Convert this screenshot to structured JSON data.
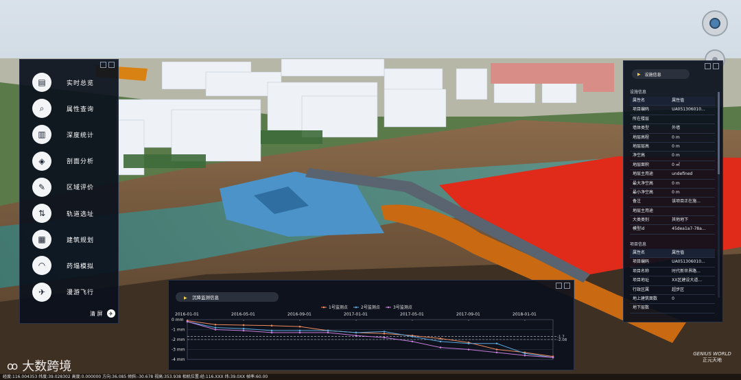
{
  "left_menu": {
    "items": [
      {
        "label": "实时总览",
        "icon": "dashboard-icon"
      },
      {
        "label": "属性查询",
        "icon": "property-search-icon"
      },
      {
        "label": "深度统计",
        "icon": "statistics-icon"
      },
      {
        "label": "剖面分析",
        "icon": "section-analysis-icon"
      },
      {
        "label": "区域评价",
        "icon": "area-evaluation-icon"
      },
      {
        "label": "轨道选址",
        "icon": "rail-site-icon"
      },
      {
        "label": "建筑规划",
        "icon": "building-plan-icon"
      },
      {
        "label": "药塌模拟",
        "icon": "collapse-sim-icon"
      },
      {
        "label": "漫游飞行",
        "icon": "plane-icon"
      }
    ],
    "clear_label": "清 屏"
  },
  "right_panel": {
    "header": "设施信息",
    "facility": {
      "title": "设施信息",
      "col_name": "属性名",
      "col_value": "属性值",
      "rows": [
        {
          "k": "项目编码",
          "v": "UA051306010..."
        },
        {
          "k": "所在楼层",
          "v": ""
        },
        {
          "k": "墙体类型",
          "v": "外墙"
        },
        {
          "k": "地层高程",
          "v": "0 m"
        },
        {
          "k": "地层层高",
          "v": "0 m"
        },
        {
          "k": "净空高",
          "v": "0 m"
        },
        {
          "k": "地层面积",
          "v": "0 ㎡"
        },
        {
          "k": "地层主用途",
          "v": "undefined"
        },
        {
          "k": "最大净空高",
          "v": "0 m"
        },
        {
          "k": "最小净空高",
          "v": "0 m"
        },
        {
          "k": "备注",
          "v": "该项目正在施..."
        },
        {
          "k": "地层主用途",
          "v": ""
        },
        {
          "k": "大类类别",
          "v": "其他地下"
        },
        {
          "k": "模型id",
          "v": "45dea1a7-78a..."
        }
      ]
    },
    "project": {
      "title": "项目信息",
      "col_name": "属性名",
      "col_value": "属性值",
      "rows": [
        {
          "k": "项目编码",
          "v": "UA051306010..."
        },
        {
          "k": "项目名称",
          "v": "时代新世界路..."
        },
        {
          "k": "项目地址",
          "v": "XX区建设大道..."
        },
        {
          "k": "行政区属",
          "v": "超步区"
        },
        {
          "k": "地上建筑面数",
          "v": "0"
        },
        {
          "k": "地下层数",
          "v": ""
        }
      ]
    }
  },
  "chart_panel": {
    "header": "沉降监测信息"
  },
  "chart_data": {
    "type": "line",
    "x": [
      "2016-01-01",
      "2016-03-01",
      "2016-05-01",
      "2016-07-01",
      "2016-09-01",
      "2016-11-01",
      "2017-01-01",
      "2017-03-01",
      "2017-05-01",
      "2017-07-01",
      "2017-09-01",
      "2017-11-01",
      "2018-01-01",
      "2018-03-01"
    ],
    "x_ticks": [
      "2016-01-01",
      "2016-05-01",
      "2016-09-01",
      "2017-01-01",
      "2017-05-01",
      "2017-09-01",
      "2018-01-01"
    ],
    "y_ticks": [
      "0 mm",
      "-1 mm",
      "-2 mm",
      "-3 mm",
      "-4 mm"
    ],
    "ylim": [
      -4,
      0
    ],
    "series": [
      {
        "name": "1号监测点",
        "color": "#f08a5d",
        "values": [
          -0.1,
          -0.5,
          -0.55,
          -0.6,
          -0.7,
          -1.1,
          -1.3,
          -1.4,
          -1.6,
          -1.9,
          -2.3,
          -3.0,
          -3.3,
          -3.7
        ]
      },
      {
        "name": "2号监测点",
        "color": "#5aa8e0",
        "values": [
          -0.2,
          -0.8,
          -0.9,
          -1.1,
          -1.1,
          -1.1,
          -1.3,
          -1.2,
          -1.7,
          -2.2,
          -2.4,
          -2.4,
          -3.4,
          -3.8
        ]
      },
      {
        "name": "3号监测点",
        "color": "#c77ddb",
        "values": [
          -0.2,
          -1.0,
          -1.1,
          -1.3,
          -1.3,
          -1.3,
          -1.6,
          -1.8,
          -2.2,
          -2.8,
          -3.0,
          -3.3,
          -3.6,
          -3.8
        ]
      }
    ],
    "ref_lines": [
      {
        "value": -1.7,
        "label": "-1.7"
      },
      {
        "value": -2.0,
        "label": "-2.08"
      }
    ]
  },
  "watermarks": {
    "brand_left": "大数跨境",
    "brand_right": "GENIUS WORLD",
    "brand_right_sub": "正元天地"
  },
  "status_bar": "经度:116.004353   纬度:39.028302   高度:0.000000   方向:36.085   倾斜:-30.678   视高:353.938   相机位置:经:116.XXX 纬:39.0XX   帧率:60.00"
}
